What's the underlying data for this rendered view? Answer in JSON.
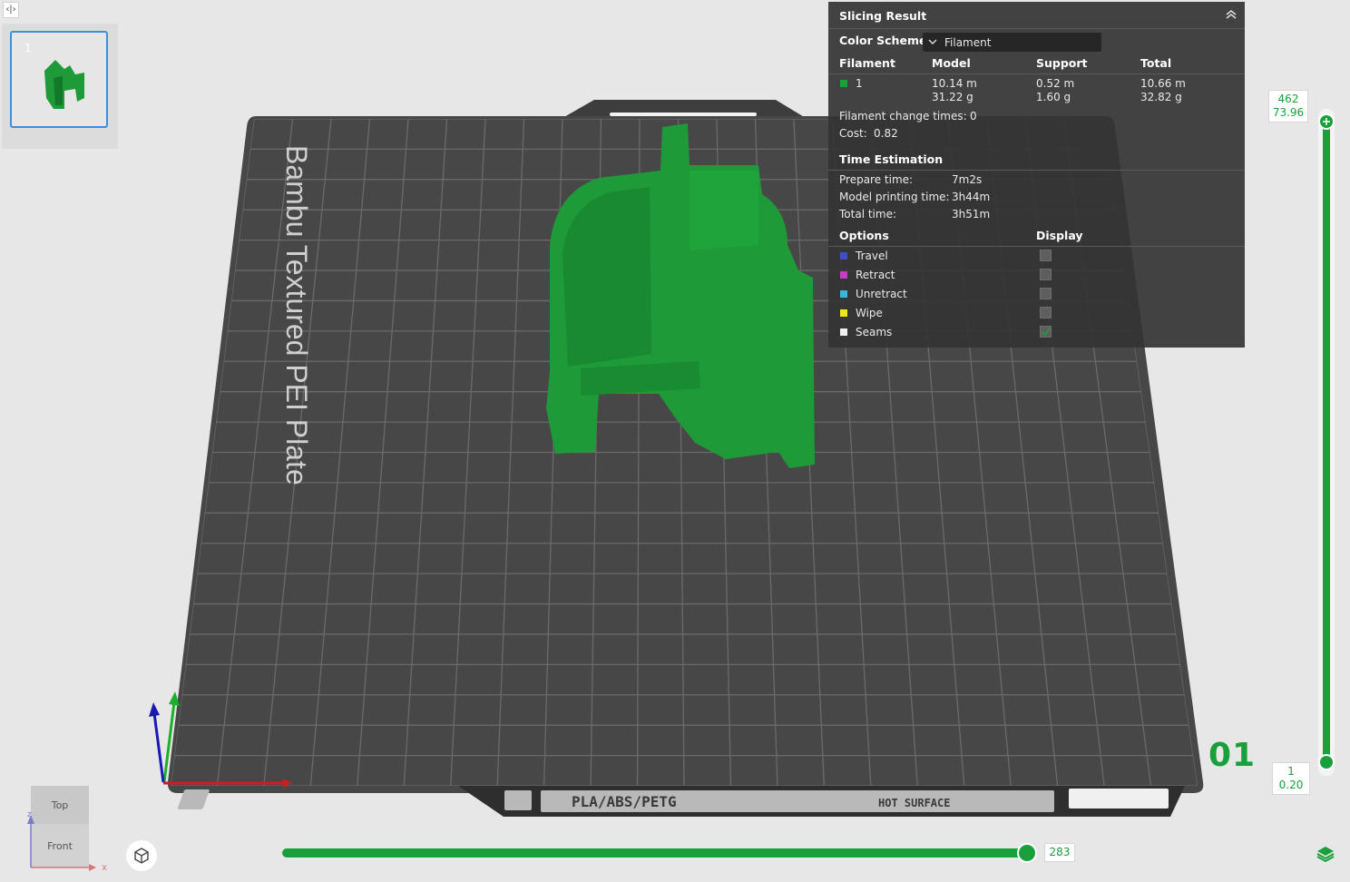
{
  "plates": [
    {
      "number": "1"
    }
  ],
  "plate_name": "Bambu Textured PEI Plate",
  "plate_markings": {
    "material": "PLA/ABS/PETG",
    "surface": "HOT SURFACE"
  },
  "slicing_result": {
    "title": "Slicing Result",
    "color_scheme_label": "Color Scheme",
    "color_scheme_value": "Filament",
    "columns": [
      "Filament",
      "Model",
      "Support",
      "Total"
    ],
    "filaments": [
      {
        "id": "1",
        "color": "#1aa03a",
        "model_len": "10.14 m",
        "model_weight": "31.22 g",
        "support_len": "0.52 m",
        "support_weight": "1.60 g",
        "total_len": "10.66 m",
        "total_weight": "32.82 g"
      }
    ],
    "filament_change_label": "Filament change times:",
    "filament_change_value": "0",
    "cost_label": "Cost:",
    "cost_value": "0.82",
    "time_title": "Time Estimation",
    "times": [
      {
        "label": "Prepare time:",
        "value": "7m2s"
      },
      {
        "label": "Model printing time:",
        "value": "3h44m"
      },
      {
        "label": "Total time:",
        "value": "3h51m"
      }
    ],
    "options_title": "Options",
    "display_title": "Display",
    "options": [
      {
        "label": "Travel",
        "color": "#3f4fc8",
        "checked": false
      },
      {
        "label": "Retract",
        "color": "#c83cc8",
        "checked": false
      },
      {
        "label": "Unretract",
        "color": "#3cb4dc",
        "checked": false
      },
      {
        "label": "Wipe",
        "color": "#f0e614",
        "checked": false
      },
      {
        "label": "Seams",
        "color": "#f0f0f0",
        "checked": true
      }
    ]
  },
  "layer_slider": {
    "top_layer": "462",
    "top_height": "73.96",
    "bottom_layer": "1",
    "bottom_height": "0.20",
    "plate_index_display": "01"
  },
  "move_slider": {
    "value": "283"
  },
  "view_cube": {
    "top_label": "Top",
    "front_label": "Front",
    "axis_x": "x",
    "axis_z": "z"
  },
  "colors": {
    "accent": "#1aa03a",
    "panel_bg": "#343434",
    "bed": "#4a4a4a"
  }
}
